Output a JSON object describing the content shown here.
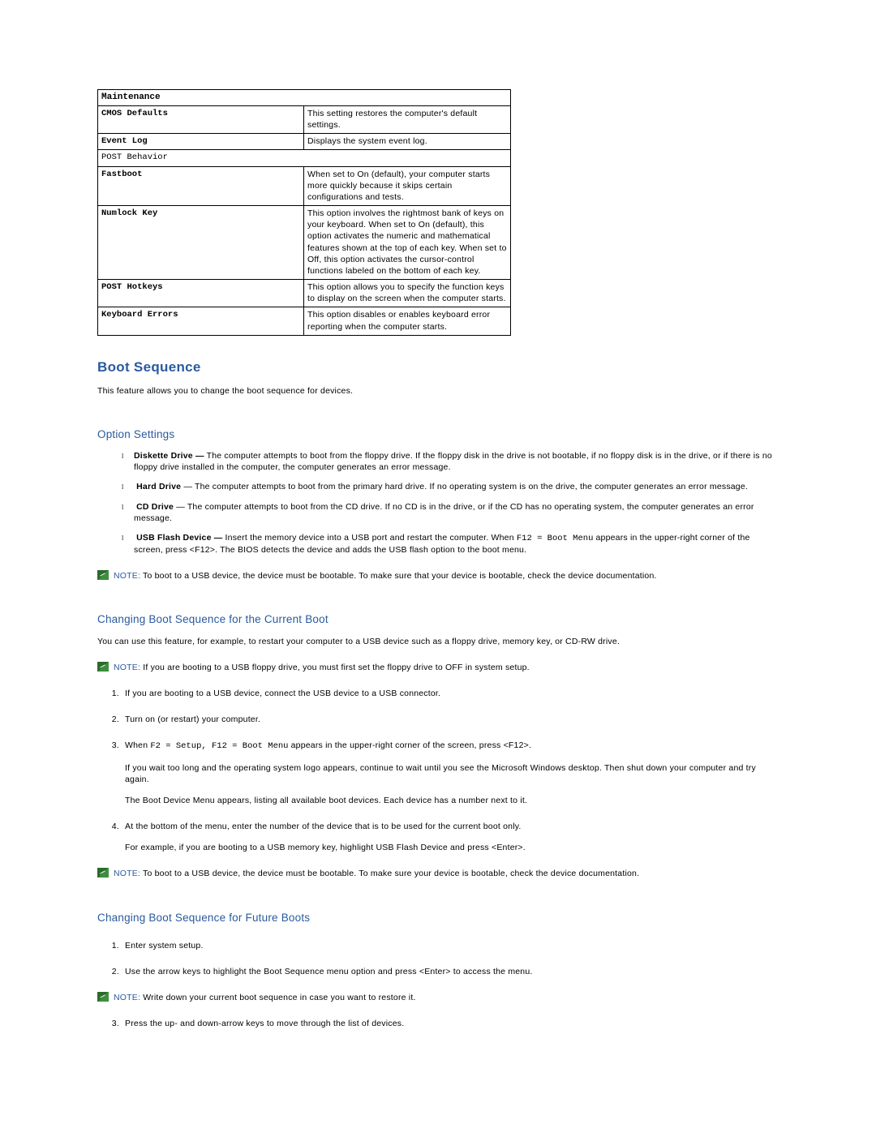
{
  "table": {
    "section1": "Maintenance",
    "r1h": "CMOS Defaults",
    "r1d": "This setting restores the computer's default settings.",
    "r2h": "Event Log",
    "r2d": "Displays the system event log.",
    "nested_section": "POST Behavior",
    "r3h": "Fastboot",
    "r3d": "When set to On (default), your computer starts more quickly because it skips certain configurations and tests.",
    "r4h": "Numlock Key",
    "r4d": "This option involves the rightmost bank of keys on your keyboard. When set to On (default), this option activates the numeric and mathematical features shown at the top of each key. When set to Off, this option activates the cursor-control functions labeled on the bottom of each key.",
    "r5h": "POST Hotkeys",
    "r5d": "This option allows you to specify the function keys to display on the screen when the computer starts.",
    "r6h": "Keyboard Errors",
    "r6d": "This option disables or enables keyboard error reporting when the computer starts."
  },
  "headings": {
    "boot_sequence": "Boot Sequence",
    "option_settings": "Option Settings",
    "changing_current": "Changing Boot Sequence for the Current Boot",
    "changing_future": "Changing Boot Sequence for Future Boots"
  },
  "intro": "This feature allows you to change the boot sequence for devices.",
  "options": {
    "o1n": "Diskette Drive —",
    "o1d": " The computer attempts to boot from the floppy drive. If the floppy disk in the drive is not bootable, if no floppy disk is in the drive, or if there is no floppy drive installed in the computer, the computer generates an error message.",
    "o2n": " Hard Drive",
    "o2d": " — The computer attempts to boot from the primary hard drive. If no operating system is on the drive, the computer generates an error message.",
    "o3n": " CD Drive",
    "o3d": " — The computer attempts to boot from the CD drive. If no CD is in the drive, or if the CD has no operating system, the computer generates an error message.",
    "o4n": " USB Flash Device —",
    "o4d_a": " Insert the memory device into a USB port and restart the computer. When ",
    "o4d_mono": "F12 = Boot Menu",
    "o4d_b": " appears in the upper-right corner of the screen, press <F12>. The BIOS detects the device and adds the USB flash option to the boot menu."
  },
  "notes": {
    "label": "NOTE:",
    "n1": " To boot to a USB device, the device must be bootable. To make sure that your device is bootable, check the device documentation.",
    "n2": " If you are booting to a USB floppy drive, you must first set the floppy drive to OFF in system setup.",
    "n3": " To boot to a USB device, the device must be bootable. To make sure your device is bootable, check the device documentation.",
    "n4": " Write down your current boot sequence in case you want to restore it."
  },
  "current_intro": "You can use this feature, for example, to restart your computer to a USB device such as a floppy drive, memory key, or CD-RW drive.",
  "steps_current": {
    "s1": "If you are booting to a USB device, connect the USB device to a USB connector.",
    "s2": "Turn on (or restart) your computer.",
    "s3a": "When ",
    "s3mono": "F2 = Setup, F12 = Boot Menu",
    "s3b": " appears in the upper-right corner of the screen, press <F12>.",
    "s3p1": "If you wait too long and the operating system logo appears, continue to wait until you see the Microsoft Windows desktop. Then shut down your computer and try again.",
    "s3p2": "The Boot Device Menu appears, listing all available boot devices. Each device has a number next to it.",
    "s4": "At the bottom of the menu, enter the number of the device that is to be used for the current boot only.",
    "s4p1": "For example, if you are booting to a USB memory key, highlight USB Flash Device and press <Enter>."
  },
  "steps_future": {
    "s1": "Enter system setup.",
    "s2": "Use the arrow keys to highlight the Boot Sequence menu option and press <Enter> to access the menu.",
    "s3": "Press the up- and down-arrow keys to move through the list of devices."
  }
}
